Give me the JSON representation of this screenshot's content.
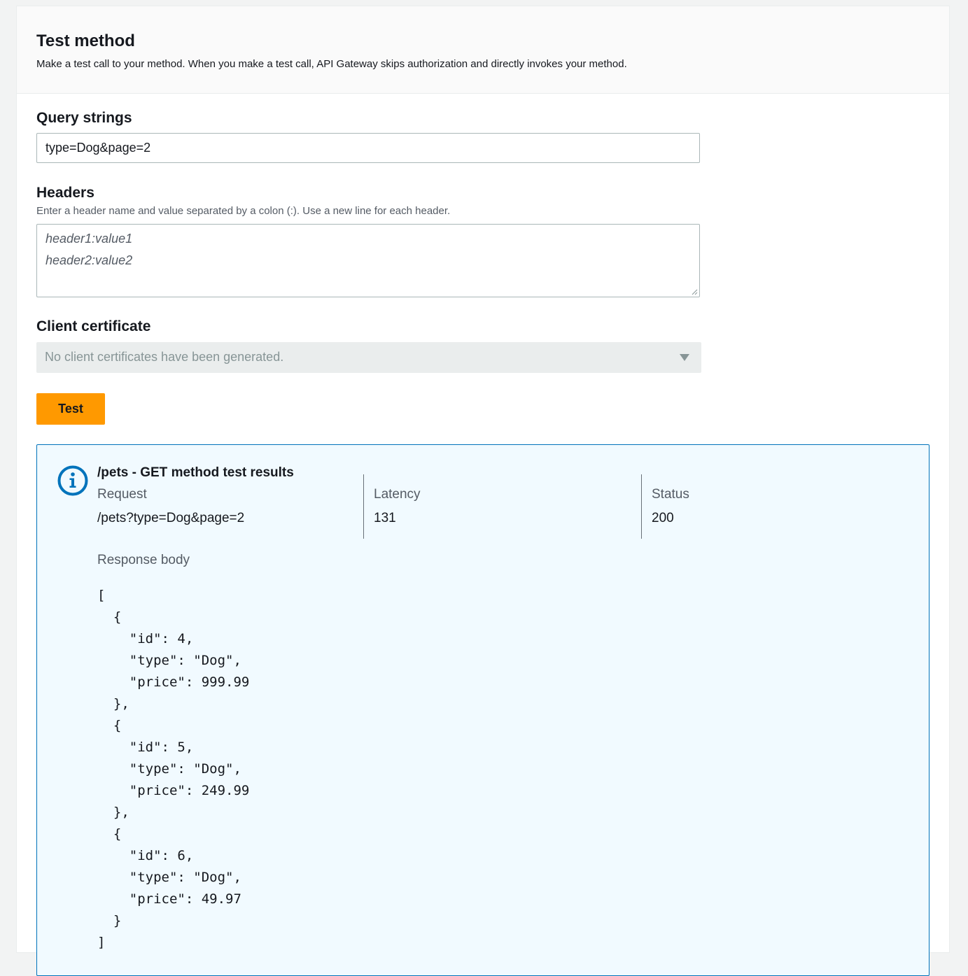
{
  "panel": {
    "title": "Test method",
    "description": "Make a test call to your method. When you make a test call, API Gateway skips authorization and directly invokes your method."
  },
  "query_strings": {
    "label": "Query strings",
    "value": "type=Dog&page=2"
  },
  "headers": {
    "label": "Headers",
    "hint": "Enter a header name and value separated by a colon (:). Use a new line for each header.",
    "placeholder_lines": [
      "header1:value1",
      "header2:value2"
    ]
  },
  "client_certificate": {
    "label": "Client certificate",
    "selected": "No client certificates have been generated."
  },
  "test_button": {
    "label": "Test"
  },
  "results": {
    "title": "/pets - GET method test results",
    "request_label": "Request",
    "request_value": "/pets?type=Dog&page=2",
    "latency_label": "Latency",
    "latency_value": "131",
    "status_label": "Status",
    "status_value": "200",
    "response_body_label": "Response body",
    "response_body": "[\n  {\n    \"id\": 4,\n    \"type\": \"Dog\",\n    \"price\": 999.99\n  },\n  {\n    \"id\": 5,\n    \"type\": \"Dog\",\n    \"price\": 249.99\n  },\n  {\n    \"id\": 6,\n    \"type\": \"Dog\",\n    \"price\": 49.97\n  }\n]"
  },
  "icons": {
    "info": "info-icon",
    "dropdown": "caret-down-icon",
    "resize": "resize-grip-icon"
  },
  "colors": {
    "primary_button": "#ff9900",
    "info_border": "#0073bb",
    "info_background": "#f1faff",
    "header_background": "#fafafa"
  }
}
